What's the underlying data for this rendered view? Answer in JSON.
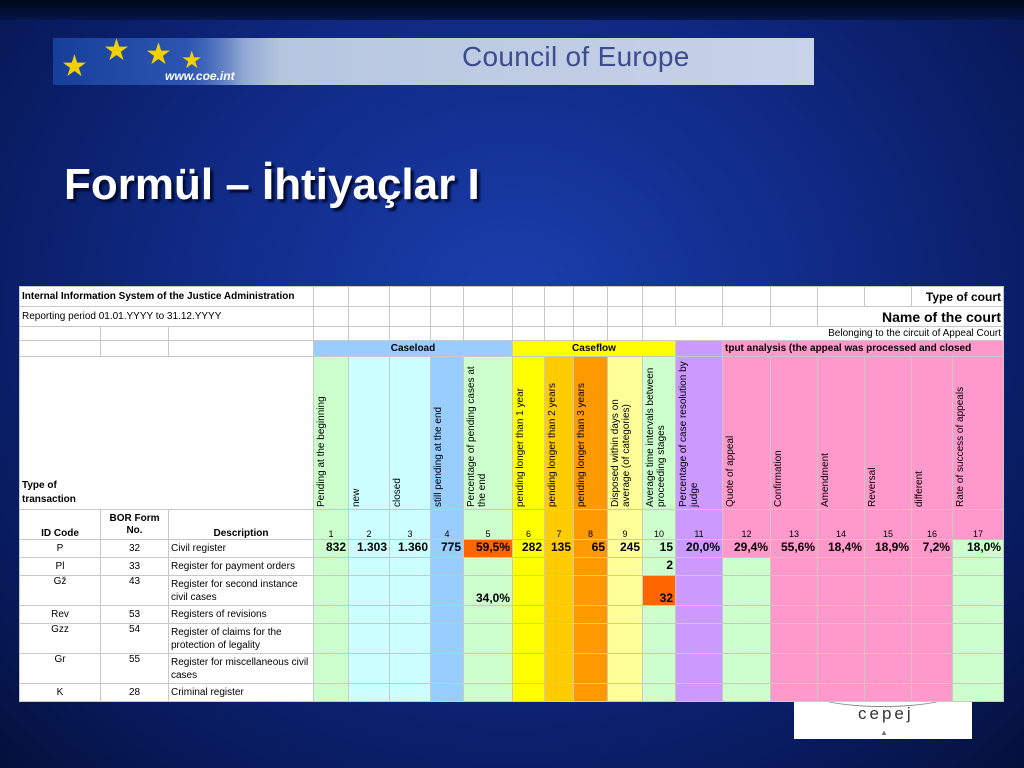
{
  "banner": {
    "url": "www.coe.int",
    "org": "Council of Europe"
  },
  "slide_title": "Formül – İhtiyaçlar I",
  "cepej_logo": "cepej",
  "sheet": {
    "system_title": "Internal Information System of the Justice Administration",
    "type_of_court": "Type of court",
    "reporting_period": "Reporting period 01.01.YYYY to 31.12.YYYY",
    "name_of_court": "Name of the court",
    "circuit": "Belonging to the circuit of Appeal Court",
    "groups": {
      "caseload": "Caseload",
      "caseflow": "Caseflow",
      "output": "tput analysis (the appeal was processed and closed"
    },
    "type_of_transaction": "Type of transaction",
    "columns": [
      "Pending at the beginning",
      "new",
      "closed",
      "still pending at the end",
      "Percentage of pending cases at the end",
      "pending longer than 1 year",
      "pending longer than 2 years",
      "pending longer than 3 years",
      "Disposed within days on average (of categories)",
      "Average time intervals between proceeding stages",
      "Percentage of case resolution by judge",
      "Quote of appeal",
      "Confirmation",
      "Amendment",
      "Reversal",
      "different",
      "Rate of success of appeals"
    ],
    "headers": {
      "id_code": "ID Code",
      "bor_form": "BOR Form No.",
      "description": "Description"
    },
    "col_numbers": [
      "1",
      "2",
      "3",
      "4",
      "5",
      "6",
      "7",
      "8",
      "9",
      "10",
      "11",
      "12",
      "13",
      "14",
      "15",
      "16",
      "17"
    ],
    "rows": [
      {
        "id": "P",
        "bor": "32",
        "desc": "Civil register"
      },
      {
        "id": "Pl",
        "bor": "33",
        "desc": "Register for payment orders"
      },
      {
        "id": "Gž",
        "bor": "43",
        "desc": "Register for second instance civil cases"
      },
      {
        "id": "Rev",
        "bor": "53",
        "desc": "Registers of revisions"
      },
      {
        "id": "Gzz",
        "bor": "54",
        "desc": "Register of claims for the protection of legality"
      },
      {
        "id": "Gr",
        "bor": "55",
        "desc": "Register for miscellaneous civil cases"
      },
      {
        "id": "K",
        "bor": "28",
        "desc": "Criminal register"
      }
    ],
    "values_p": [
      "832",
      "1.303",
      "1.360",
      "775",
      "59,5%",
      "282",
      "135",
      "65",
      "245",
      "15",
      "20,0%",
      "29,4%",
      "55,6%",
      "18,4%",
      "18,9%",
      "7,2%",
      "18,0%"
    ],
    "value_col10_row2": "2",
    "value_col5_row3": "34,0%",
    "value_col10_row3": "32"
  },
  "colors": {
    "caseload": "#99ccff",
    "caseflow": "#ffff00",
    "output": "#ff99cc",
    "percent_pending": "#ff6600",
    "col11": "#cc99ff"
  }
}
